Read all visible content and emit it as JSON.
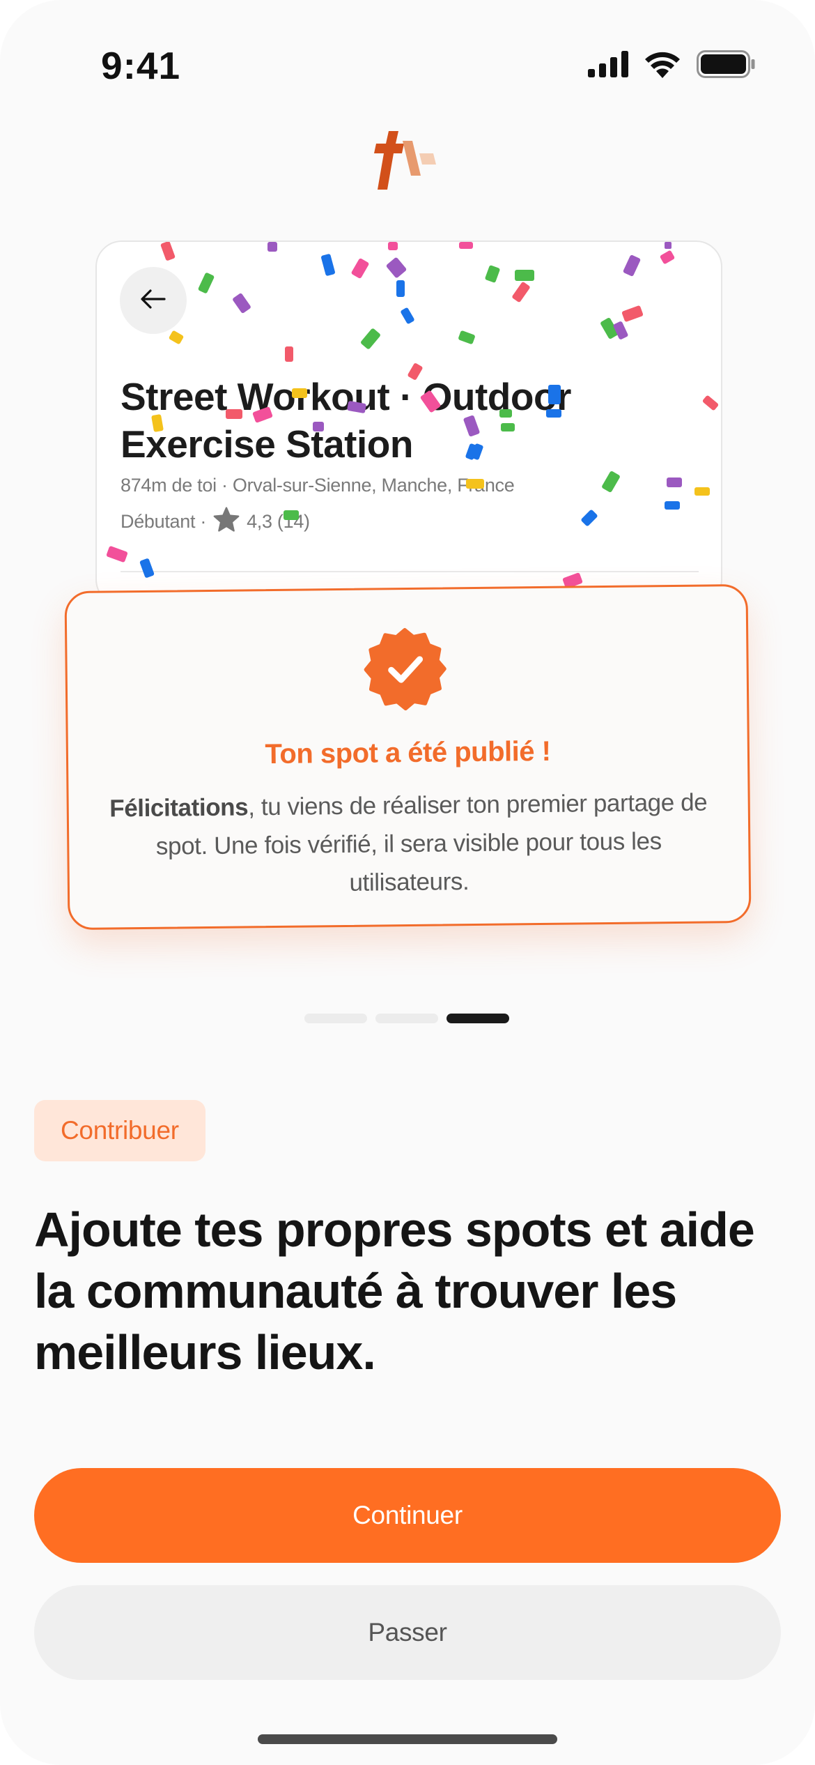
{
  "status_bar": {
    "time": "9:41",
    "icons": [
      "signal-icon",
      "wifi-icon",
      "battery-icon"
    ]
  },
  "logo": {
    "icon": "app-logo"
  },
  "spot_card": {
    "back_icon": "arrow-left-icon",
    "title": "Street Workout · Outdoor Exercise Station",
    "location": "874m de toi · Orval-sur-Sienne, Manche, France",
    "level": "Débutant ·",
    "rating": "4,3 (14)",
    "star_icon": "star-icon"
  },
  "published": {
    "icon": "check-badge-icon",
    "title": "Ton spot a été publié !",
    "text_bold": "Félicitations",
    "text_rest": ", tu viens de réaliser ton premier partage de spot. Une fois vérifié, il sera visible pour tous les utilisateurs."
  },
  "pager": {
    "count": 3,
    "active_index": 2
  },
  "section_badge": "Contribuer",
  "headline": "Ajoute tes propres spots et aide la communauté à trouver les meilleurs lieux.",
  "buttons": {
    "primary": "Continuer",
    "secondary": "Passer"
  },
  "colors": {
    "accent": "#ff6e22",
    "accent_text": "#f26c2b",
    "badge_bg": "#ffe6d9",
    "text_dark": "#151515"
  }
}
